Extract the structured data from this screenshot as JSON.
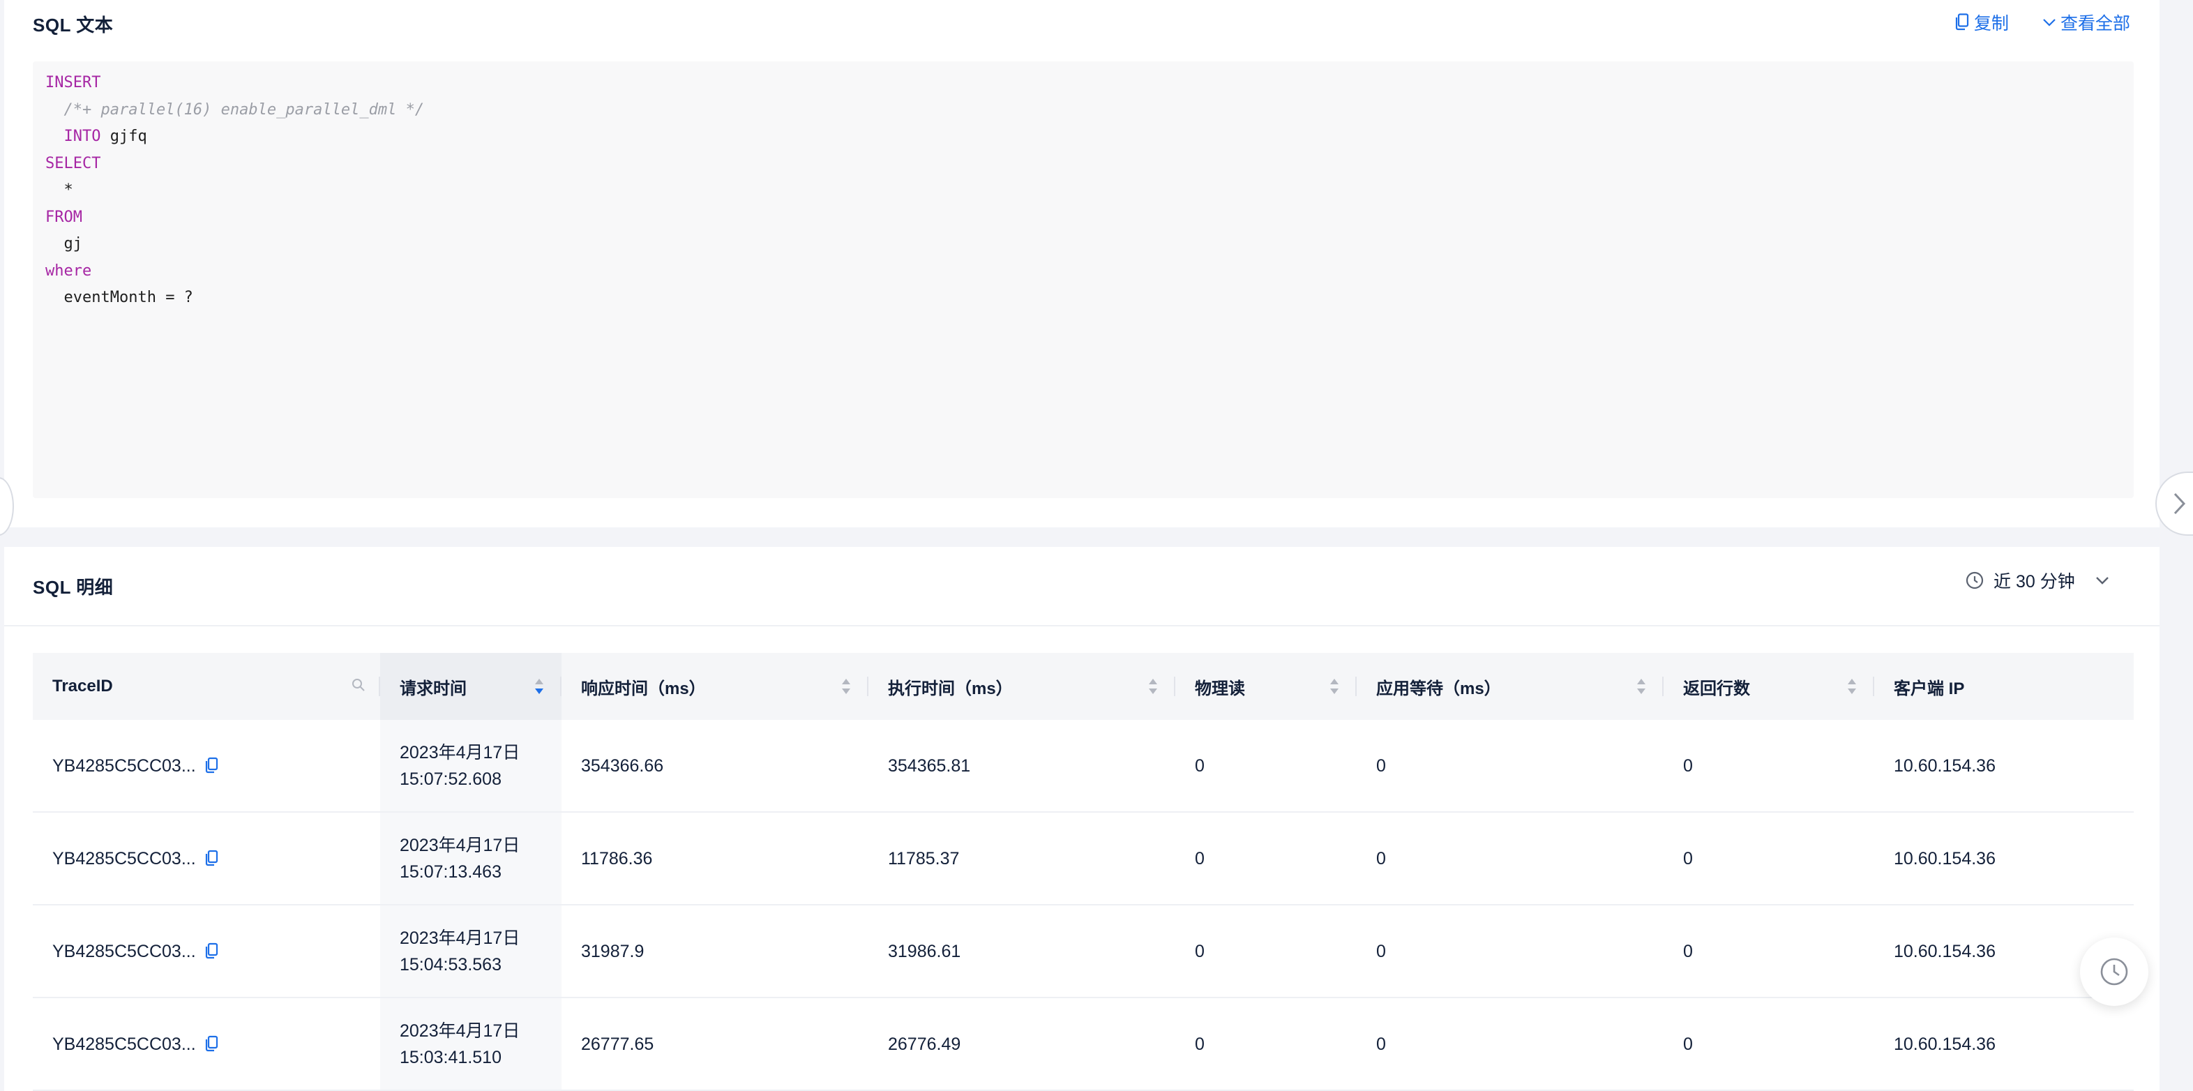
{
  "sql_text": {
    "title": "SQL 文本",
    "copy_label": "复制",
    "view_all_label": "查看全部",
    "lines": [
      {
        "indent": "",
        "kw": "INSERT",
        "rest": ""
      },
      {
        "indent": "  ",
        "comment": "/*+ parallel(16) enable_parallel_dml */"
      },
      {
        "indent": "  ",
        "kw": "INTO",
        "rest": " gjfq"
      },
      {
        "indent": "",
        "kw": "SELECT",
        "rest": ""
      },
      {
        "indent": "  ",
        "kw": "",
        "rest": "*"
      },
      {
        "indent": "",
        "kw": "FROM",
        "rest": ""
      },
      {
        "indent": "  ",
        "kw": "",
        "rest": "gj"
      },
      {
        "indent": "",
        "kw": "where",
        "rest": ""
      },
      {
        "indent": "  ",
        "kw": "",
        "rest": "eventMonth = ?"
      }
    ]
  },
  "sql_detail": {
    "title": "SQL 明细",
    "time_range": "近 30 分钟",
    "columns": [
      {
        "key": "trace",
        "label": "TraceID",
        "filter": true
      },
      {
        "key": "req_time",
        "label": "请求时间",
        "sort": "asc"
      },
      {
        "key": "resp_time",
        "label": "响应时间（ms）",
        "sort": "none"
      },
      {
        "key": "exec_time",
        "label": "执行时间（ms）",
        "sort": "none"
      },
      {
        "key": "phys_read",
        "label": "物理读",
        "sort": "none"
      },
      {
        "key": "app_wait",
        "label": "应用等待（ms）",
        "sort": "none"
      },
      {
        "key": "rows_ret",
        "label": "返回行数",
        "sort": "none"
      },
      {
        "key": "client_ip",
        "label": "客户端 IP"
      }
    ],
    "rows": [
      {
        "trace": "YB4285C5CC03...",
        "req_date": "2023年4月17日",
        "req_clock": "15:07:52.608",
        "resp_time": "354366.66",
        "exec_time": "354365.81",
        "phys_read": "0",
        "app_wait": "0",
        "rows_ret": "0",
        "client_ip": "10.60.154.36"
      },
      {
        "trace": "YB4285C5CC03...",
        "req_date": "2023年4月17日",
        "req_clock": "15:07:13.463",
        "resp_time": "11786.36",
        "exec_time": "11785.37",
        "phys_read": "0",
        "app_wait": "0",
        "rows_ret": "0",
        "client_ip": "10.60.154.36"
      },
      {
        "trace": "YB4285C5CC03...",
        "req_date": "2023年4月17日",
        "req_clock": "15:04:53.563",
        "resp_time": "31987.9",
        "exec_time": "31986.61",
        "phys_read": "0",
        "app_wait": "0",
        "rows_ret": "0",
        "client_ip": "10.60.154.36"
      },
      {
        "trace": "YB4285C5CC03...",
        "req_date": "2023年4月17日",
        "req_clock": "15:03:41.510",
        "resp_time": "26777.65",
        "exec_time": "26776.49",
        "phys_read": "0",
        "app_wait": "0",
        "rows_ret": "0",
        "client_ip": "10.60.154.36"
      }
    ]
  },
  "colors": {
    "accent": "#1d6fe8",
    "keyword": "#a626a4",
    "comment": "#9b9ea6"
  }
}
